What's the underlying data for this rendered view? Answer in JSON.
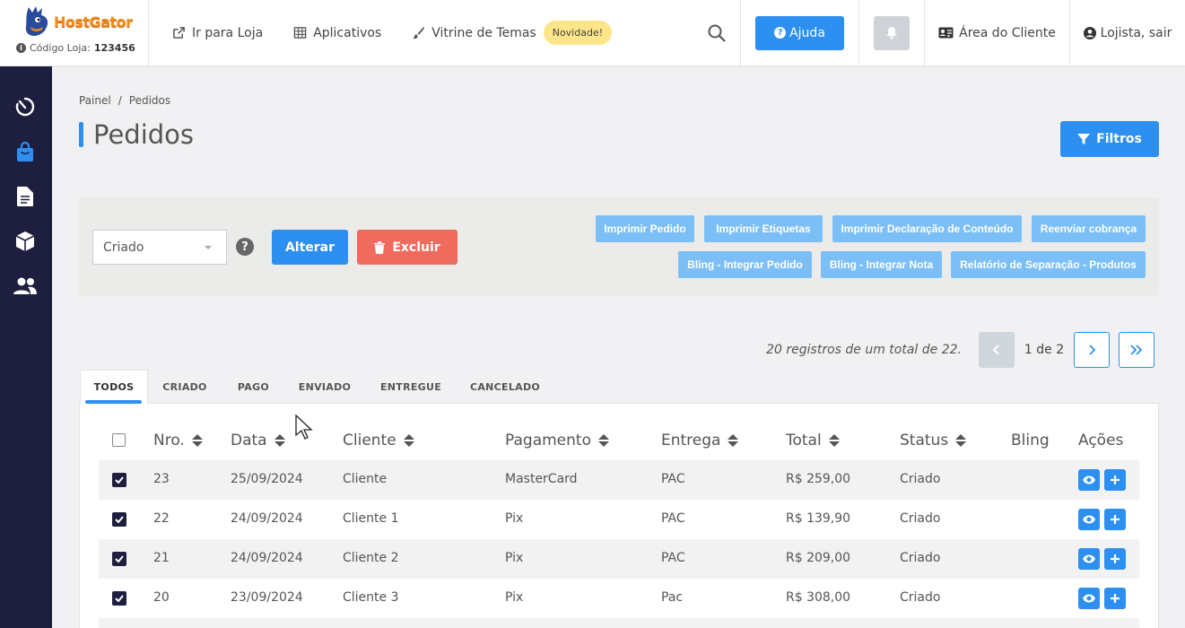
{
  "brand": {
    "logo_text": "HostGator",
    "store_code_label": "Código Loja:",
    "store_code_value": "123456"
  },
  "topnav": {
    "links": [
      {
        "label": "Ir para Loja",
        "icon": "external-link-icon"
      },
      {
        "label": "Aplicativos",
        "icon": "grid-icon"
      },
      {
        "label": "Vitrine de Temas",
        "icon": "brush-icon"
      }
    ],
    "badge": "Novidade!",
    "help_label": "Ajuda",
    "client_area_label": "Área do Cliente",
    "logout_label": "Lojista, sair"
  },
  "sidebar": {
    "items": [
      "dashboard-icon",
      "orders-bag-icon",
      "document-icon",
      "box-icon",
      "customers-icon"
    ],
    "active_index": 1
  },
  "breadcrumb": [
    "Painel",
    "/",
    "Pedidos"
  ],
  "page_title": "Pedidos",
  "filters_label": "Filtros",
  "actions": {
    "status_select_value": "Criado",
    "help_symbol": "?",
    "alter_label": "Alterar",
    "delete_label": "Excluir",
    "buttons": [
      "Imprimir Pedido",
      "Imprimir Etiquetas",
      "Imprimir Declaração de Conteúdo",
      "Reenviar cobrança",
      "Bling - Integrar Pedido",
      "Bling - Integrar Nota",
      "Relatório de Separação - Produtos"
    ]
  },
  "pagination": {
    "records_text": "20 registros de um total de 22.",
    "page_info": "1 de 2"
  },
  "tabs": [
    "TODOS",
    "CRIADO",
    "PAGO",
    "ENVIADO",
    "ENTREGUE",
    "CANCELADO"
  ],
  "table": {
    "headers": [
      "Nro.",
      "Data",
      "Cliente",
      "Pagamento",
      "Entrega",
      "Total",
      "Status",
      "Bling",
      "Ações"
    ],
    "rows": [
      {
        "nro": "23",
        "data": "25/09/2024",
        "cliente": "Cliente",
        "pagamento": "MasterCard",
        "entrega": "PAC",
        "total": "R$ 259,00",
        "status": "Criado",
        "checked": true
      },
      {
        "nro": "22",
        "data": "24/09/2024",
        "cliente": "Cliente 1",
        "pagamento": "Pix",
        "entrega": "PAC",
        "total": "R$ 139,90",
        "status": "Criado",
        "checked": true
      },
      {
        "nro": "21",
        "data": "24/09/2024",
        "cliente": "Cliente 2",
        "pagamento": "Pix",
        "entrega": "PAC",
        "total": "R$ 209,00",
        "status": "Criado",
        "checked": true
      },
      {
        "nro": "20",
        "data": "23/09/2024",
        "cliente": "Cliente 3",
        "pagamento": "Pix",
        "entrega": "Pac",
        "total": "R$ 308,00",
        "status": "Criado",
        "checked": true
      }
    ]
  },
  "colors": {
    "primary": "#2d8ff0",
    "danger": "#ef6b5e",
    "sidebar": "#1e1e3f",
    "light_action": "#7cbff7",
    "badge": "#fde68a"
  }
}
